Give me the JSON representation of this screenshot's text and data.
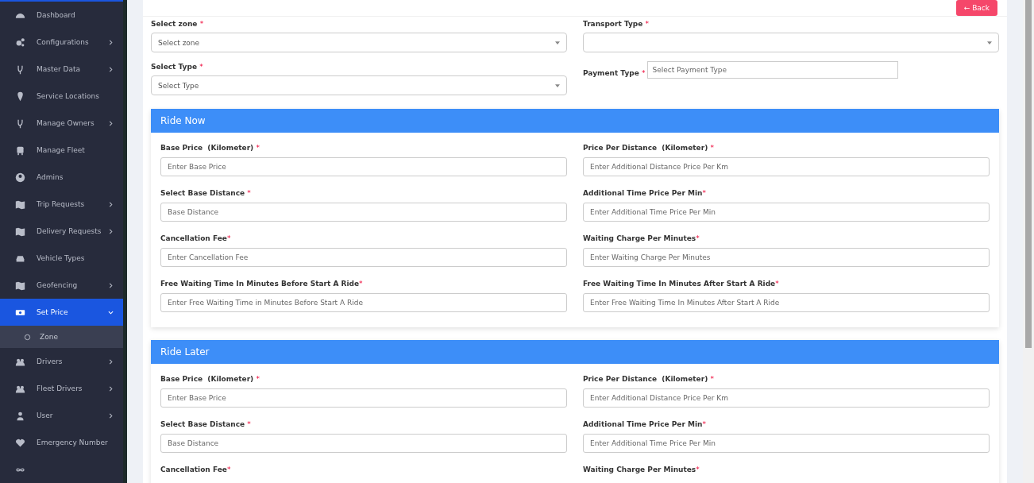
{
  "sidebar": {
    "items": [
      {
        "label": "Dashboard",
        "kind": "gauge",
        "chevron": false,
        "selected": false
      },
      {
        "label": "Configurations",
        "kind": "gears",
        "chevron": true,
        "selected": false
      },
      {
        "label": "Master Data",
        "kind": "fork",
        "chevron": true,
        "selected": false
      },
      {
        "label": "Service Locations",
        "kind": "pin",
        "chevron": false,
        "selected": false
      },
      {
        "label": "Manage Owners",
        "kind": "fork",
        "chevron": true,
        "selected": false
      },
      {
        "label": "Manage Fleet",
        "kind": "bus",
        "chevron": false,
        "selected": false
      },
      {
        "label": "Admins",
        "kind": "user-circle",
        "chevron": false,
        "selected": false
      },
      {
        "label": "Trip Requests",
        "kind": "map",
        "chevron": true,
        "selected": false
      },
      {
        "label": "Delivery Requests",
        "kind": "map",
        "chevron": true,
        "selected": false
      },
      {
        "label": "Vehicle Types",
        "kind": "car",
        "chevron": false,
        "selected": false
      },
      {
        "label": "Geofencing",
        "kind": "map",
        "chevron": true,
        "selected": false
      },
      {
        "label": "Set Price",
        "kind": "money",
        "chevron": true,
        "selected": true,
        "expanded": true,
        "children": [
          {
            "label": "Zone",
            "selected": false
          }
        ]
      },
      {
        "label": "Drivers",
        "kind": "users",
        "chevron": true,
        "selected": false
      },
      {
        "label": "Fleet Drivers",
        "kind": "users",
        "chevron": true,
        "selected": false
      },
      {
        "label": "User",
        "kind": "user",
        "chevron": true,
        "selected": false
      },
      {
        "label": "Emergency Number",
        "kind": "heart",
        "chevron": false,
        "selected": false
      }
    ]
  },
  "back_button": {
    "arrow": "←",
    "label": "Back"
  },
  "top_fields": [
    {
      "kind": "select",
      "label": "Select zone",
      "mark": "*",
      "value": "Select zone"
    },
    {
      "kind": "select",
      "label": "Transport Type",
      "mark": "*"
    },
    {
      "kind": "select",
      "label": "Select Type",
      "mark": "*",
      "value": "Select Type"
    },
    {
      "kind": "inline",
      "label": "Payment Type",
      "mark": "*",
      "placeholder": "Select Payment Type"
    }
  ],
  "sections": [
    {
      "title": "Ride Now",
      "fields": [
        {
          "label": "Base Price  (Kilometer) ",
          "mark": "*",
          "placeholder": "Enter Base Price"
        },
        {
          "label": "Price Per Distance  (Kilometer) ",
          "mark": "*",
          "placeholder": "Enter Additional Distance Price Per Km"
        },
        {
          "label": "Select Base Distance ",
          "mark": "*",
          "placeholder": "Base Distance"
        },
        {
          "label": "Additional Time Price Per Min",
          "mark": "*",
          "placeholder": "Enter Additional Time Price Per Min"
        },
        {
          "label": "Cancellation Fee",
          "mark": "*",
          "placeholder": "Enter Cancellation Fee"
        },
        {
          "label": "Waiting Charge Per Minutes",
          "mark": "*",
          "placeholder": "Enter Waiting Charge Per Minutes"
        },
        {
          "label": "Free Waiting Time In Minutes Before Start A Ride",
          "mark": "*",
          "placeholder": "Enter Free Waiting Time in Minutes Before Start A Ride"
        },
        {
          "label": "Free Waiting Time In Minutes After Start A Ride",
          "mark": "*",
          "placeholder": "Enter Free Waiting Time In Minutes After Start A Ride"
        }
      ]
    },
    {
      "title": "Ride Later",
      "fields": [
        {
          "label": "Base Price  (Kilometer) ",
          "mark": "*",
          "placeholder": "Enter Base Price"
        },
        {
          "label": "Price Per Distance  (Kilometer) ",
          "mark": "*",
          "placeholder": "Enter Additional Distance Price Per Km"
        },
        {
          "label": "Select Base Distance ",
          "mark": "*",
          "placeholder": "Base Distance"
        },
        {
          "label": "Additional Time Price Per Min",
          "mark": "*",
          "placeholder": "Enter Additional Time Price Per Min"
        },
        {
          "label": "Cancellation Fee",
          "mark": "*"
        },
        {
          "label": "Waiting Charge Per Minutes",
          "mark": "*"
        }
      ]
    }
  ]
}
